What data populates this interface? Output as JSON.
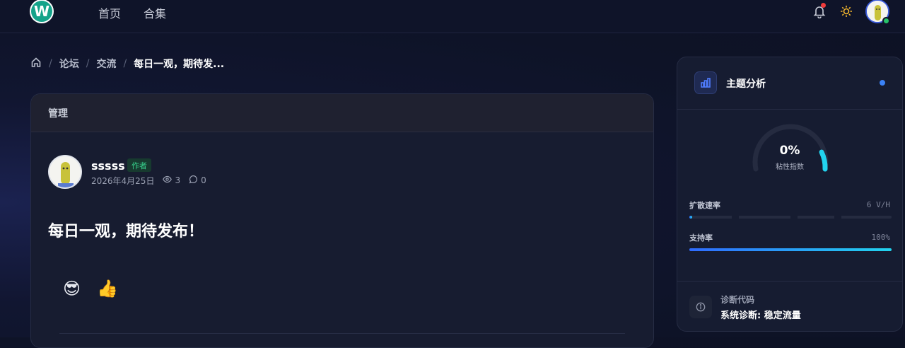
{
  "nav": {
    "home": "首页",
    "collections": "合集",
    "logo_letter": "W"
  },
  "breadcrumb": {
    "items": [
      "论坛",
      "交流"
    ],
    "current": "每日一观，期待发..."
  },
  "card": {
    "header": "管理",
    "author": {
      "name": "sssss",
      "badge": "作者",
      "date": "2026年4月25日",
      "views": "3",
      "comments": "0"
    },
    "title": "每日一观，期待发布！",
    "emojis": [
      "😎",
      "👍"
    ]
  },
  "panel": {
    "title": "主题分析",
    "gauge_value": "0%",
    "gauge_label": "粘性指数",
    "metrics": [
      {
        "label": "扩散速率",
        "value": "6 V/H",
        "fill": 0.01
      },
      {
        "label": "支持率",
        "value": "100%",
        "fill": 1.0
      }
    ],
    "diag_label": "诊断代码",
    "diag_value": "系统诊断: 稳定流量"
  },
  "colors": {
    "accent": "#3b82f6",
    "cyan": "#22d3ee",
    "badge_green": "#37d08b",
    "notify_red": "#ef3b3b"
  }
}
